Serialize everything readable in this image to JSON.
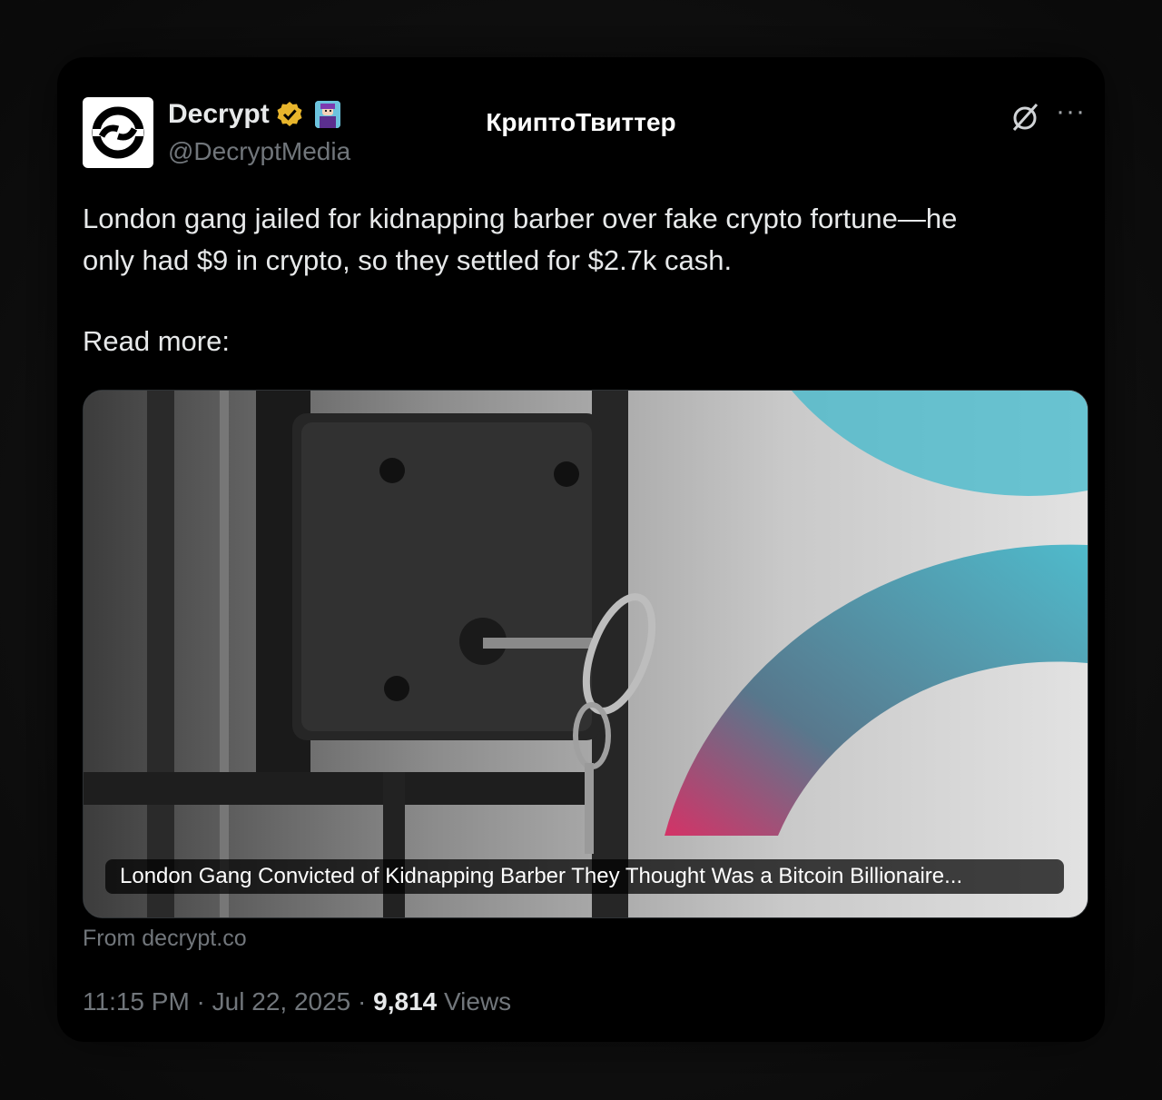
{
  "author": {
    "name": "Decrypt",
    "handle": "@DecryptMedia"
  },
  "header": {
    "title": "КриптоТвиттер"
  },
  "tweet": {
    "text_line1": "London gang jailed for kidnapping barber over fake crypto fortune—he",
    "text_line2": "only had $9 in crypto, so they settled for $2.7k cash.",
    "read_more": "Read more:"
  },
  "card": {
    "caption": "London Gang Convicted of Kidnapping Barber They Thought Was a Bitcoin Billionaire...",
    "source": "From decrypt.co"
  },
  "meta": {
    "time": "11:15 PM",
    "separator": " · ",
    "date": "Jul 22, 2025",
    "views_count": "9,814",
    "views_label": "Views"
  },
  "icons": {
    "avatar": "decrypt-logo-icon",
    "verified": "verified-badge-icon",
    "affiliate": "affiliate-badge-icon",
    "grok": "grok-icon",
    "more": "more-icon"
  },
  "colors": {
    "background": "#000000",
    "text": "#e7e9ea",
    "muted": "#71767b",
    "verified": "#e8b52c"
  }
}
